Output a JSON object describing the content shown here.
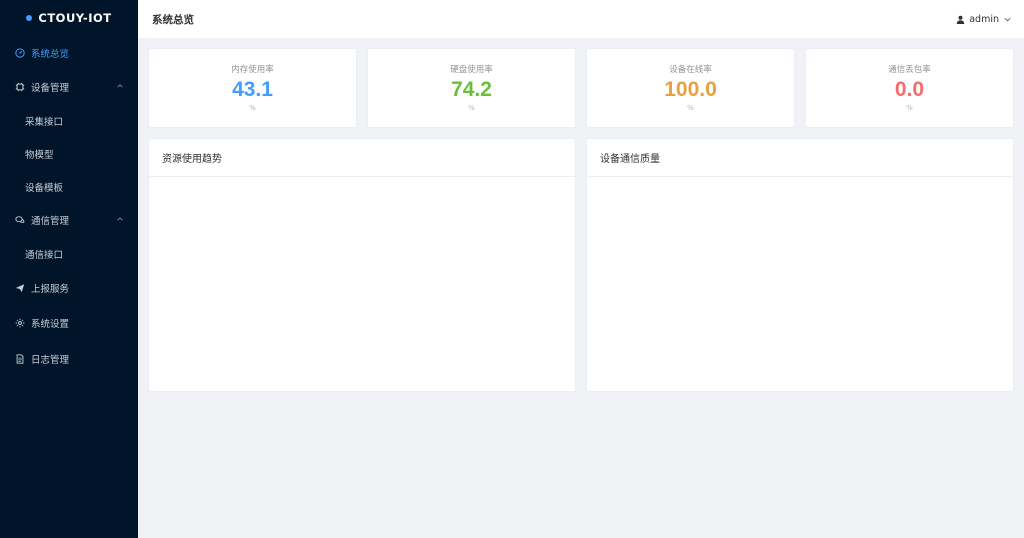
{
  "app": {
    "logo_text": "CTOUY-IOT"
  },
  "sidebar": {
    "items": [
      {
        "label": "系统总览",
        "icon": "dashboard-icon",
        "active": true
      },
      {
        "label": "设备管理",
        "icon": "chip-icon",
        "expanded": true,
        "children": [
          {
            "label": "采集接口"
          },
          {
            "label": "物模型"
          },
          {
            "label": "设备模板"
          }
        ]
      },
      {
        "label": "通信管理",
        "icon": "chat-icon",
        "expanded": true,
        "children": [
          {
            "label": "通信接口"
          }
        ]
      },
      {
        "label": "上报服务",
        "icon": "paper-plane-icon"
      },
      {
        "label": "系统设置",
        "icon": "gear-icon"
      },
      {
        "label": "日志管理",
        "icon": "document-icon"
      }
    ]
  },
  "header": {
    "title": "系统总览",
    "user": "admin"
  },
  "stats": [
    {
      "label": "内存使用率",
      "value": "43.1",
      "unit": "%",
      "color": "#409eff"
    },
    {
      "label": "硬盘使用率",
      "value": "74.2",
      "unit": "%",
      "color": "#67c23a"
    },
    {
      "label": "设备在线率",
      "value": "100.0",
      "unit": "%",
      "color": "#e6a23c"
    },
    {
      "label": "通信丢包率",
      "value": "0.0",
      "unit": "%",
      "color": "#f56c6c"
    }
  ],
  "panels": [
    {
      "title": "资源使用趋势"
    },
    {
      "title": "设备通信质量"
    }
  ],
  "colors": {
    "sidebar_bg": "#001529",
    "accent": "#409eff"
  }
}
